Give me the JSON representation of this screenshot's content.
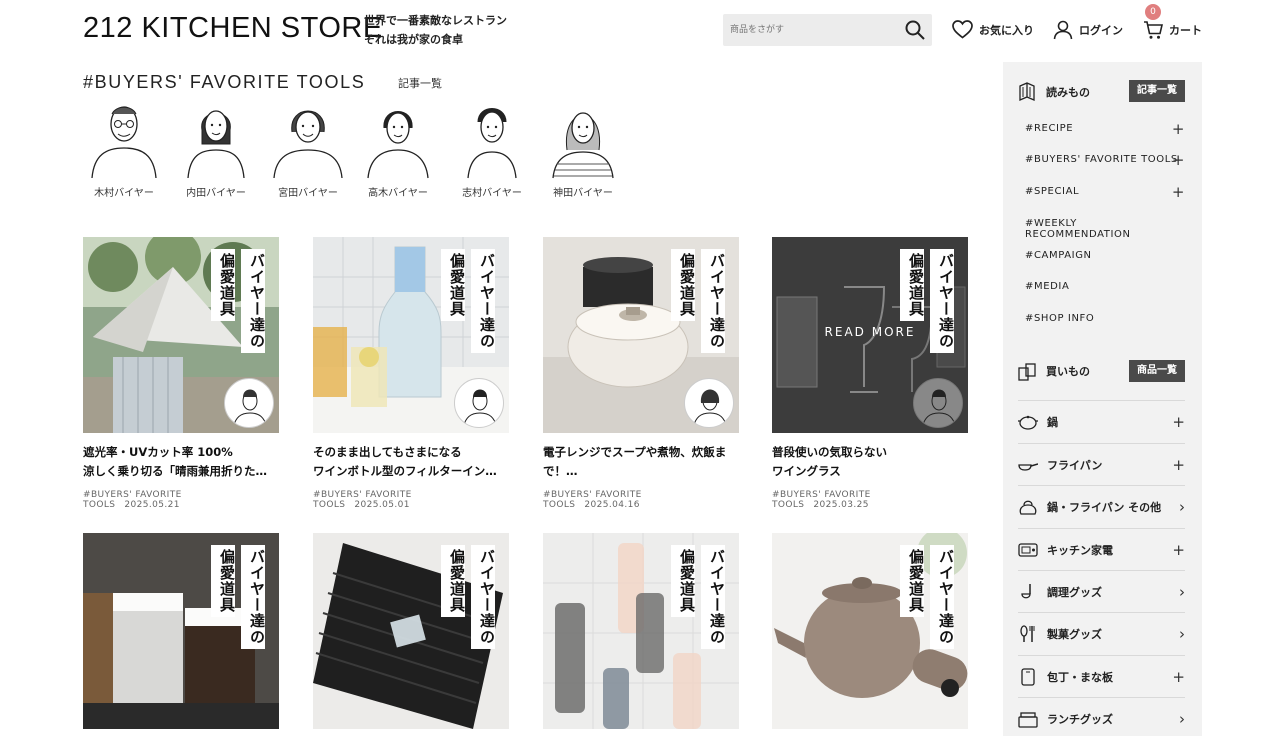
{
  "header": {
    "logo": "212 KITCHEN STORE",
    "tagline_1": "世界で一番素敵なレストラン",
    "tagline_2": "それは我が家の食卓",
    "search_placeholder": "商品をさがす",
    "favorites_label": "お気に入り",
    "login_label": "ログイン",
    "cart_label": "カート",
    "cart_count": "0"
  },
  "section": {
    "title": "#BUYERS' FAVORITE TOOLS",
    "sub": "記事一覧"
  },
  "buyers": [
    {
      "name": "木村バイヤー"
    },
    {
      "name": "内田バイヤー"
    },
    {
      "name": "宮田バイヤー"
    },
    {
      "name": "高木バイヤー"
    },
    {
      "name": "志村バイヤー"
    },
    {
      "name": "神田バイヤー"
    }
  ],
  "label": {
    "line1": "バイヤー達の",
    "line2": "偏愛道具",
    "read_more": "READ MORE"
  },
  "cards": [
    {
      "title1": "遮光率・UVカット率 100%",
      "title2": "涼しく乗り切る「晴雨兼用折りた…",
      "tag": "#BUYERS' FAVORITE TOOLS",
      "date": "2025.05.21"
    },
    {
      "title1": "そのまま出してもさまになる",
      "title2": "ワインボトル型のフィルターイン…",
      "tag": "#BUYERS' FAVORITE TOOLS",
      "date": "2025.05.01"
    },
    {
      "title1": "電子レンジでスープや煮物、炊飯ま",
      "title2": "で！…",
      "tag": "#BUYERS' FAVORITE TOOLS",
      "date": "2025.04.16"
    },
    {
      "title1": "普段使いの気取らない",
      "title2": "ワイングラス",
      "tag": "#BUYERS' FAVORITE TOOLS",
      "date": "2025.03.25"
    }
  ],
  "sidebar": {
    "read_head": "読みもの",
    "read_btn": "記事一覧",
    "read_items": [
      "#RECIPE",
      "#BUYERS' FAVORITE TOOLS",
      "#SPECIAL",
      "#WEEKLY RECOMMENDATION",
      "#CAMPAIGN",
      "#MEDIA",
      "#SHOP INFO"
    ],
    "shop_head": "買いもの",
    "shop_btn": "商品一覧",
    "categories": [
      "鍋",
      "フライパン",
      "鍋・フライパン その他",
      "キッチン家電",
      "調理グッズ",
      "製菓グッズ",
      "包丁・まな板",
      "ランチグッズ"
    ]
  }
}
